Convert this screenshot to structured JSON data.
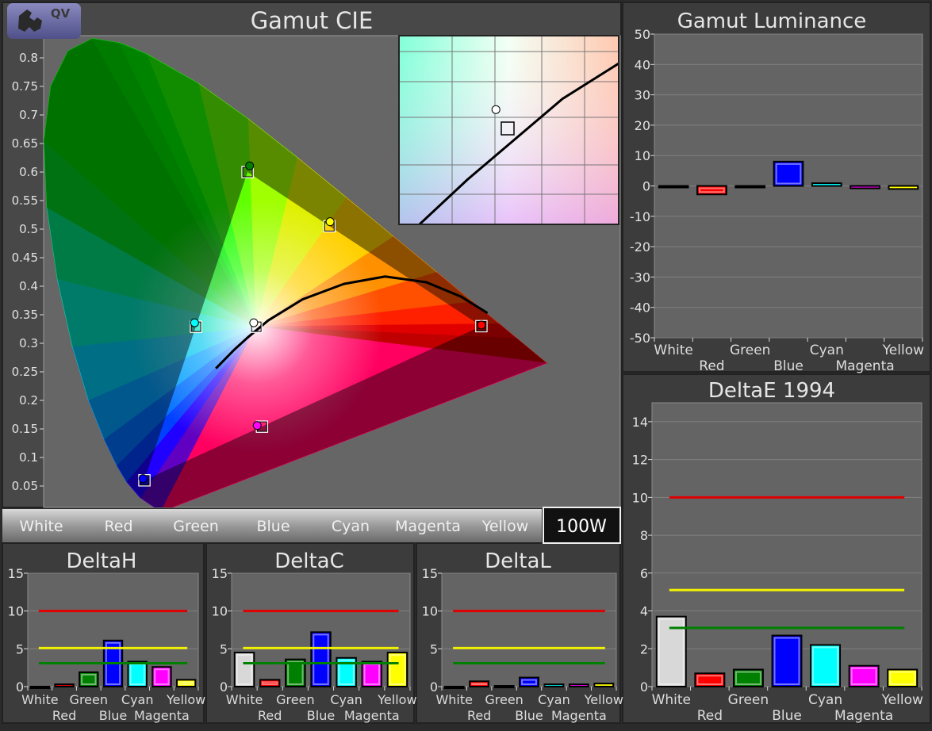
{
  "logo": {
    "text": "QV",
    "icon": "binoculars-icon"
  },
  "patch_bar": {
    "patches": [
      "White",
      "Red",
      "Green",
      "Blue",
      "Cyan",
      "Magenta",
      "Yellow"
    ],
    "selected_button": "100W"
  },
  "colors": {
    "White": "#d8d8d8",
    "Red": "#ff0000",
    "Green": "#008000",
    "Blue": "#0000ff",
    "Cyan": "#00ffff",
    "Magenta": "#ff00ff",
    "Yellow": "#ffff00",
    "threshold_high": "#e00000",
    "threshold_mid": "#f0f000",
    "threshold_low": "#008000"
  },
  "chart_data": [
    {
      "id": "cie",
      "type": "scatter",
      "title": "Gamut CIE",
      "y_ticks": [
        "0.8",
        "0.75",
        "0.7",
        "0.65",
        "0.6",
        "0.55",
        "0.5",
        "0.45",
        "0.4",
        "0.35",
        "0.3",
        "0.25",
        "0.2",
        "0.15",
        "0.1",
        "0.05"
      ],
      "categories": [
        "White",
        "Red",
        "Green",
        "Blue",
        "Cyan",
        "Magenta",
        "Yellow"
      ],
      "targets": [
        [
          0.3127,
          0.329
        ],
        [
          0.64,
          0.33
        ],
        [
          0.3,
          0.6
        ],
        [
          0.15,
          0.06
        ],
        [
          0.225,
          0.329
        ],
        [
          0.321,
          0.154
        ],
        [
          0.419,
          0.505
        ]
      ],
      "measured": [
        [
          0.309,
          0.336
        ],
        [
          0.64,
          0.332
        ],
        [
          0.303,
          0.611
        ],
        [
          0.148,
          0.063
        ],
        [
          0.223,
          0.336
        ],
        [
          0.314,
          0.156
        ],
        [
          0.42,
          0.513
        ]
      ],
      "blackbody_curve": [
        [
          0.254,
          0.256
        ],
        [
          0.28,
          0.288
        ],
        [
          0.3,
          0.31
        ],
        [
          0.33,
          0.34
        ],
        [
          0.38,
          0.377
        ],
        [
          0.44,
          0.404
        ],
        [
          0.5,
          0.417
        ],
        [
          0.56,
          0.407
        ],
        [
          0.61,
          0.382
        ],
        [
          0.649,
          0.353
        ]
      ],
      "inset": "zoom around white point"
    },
    {
      "id": "luminance",
      "type": "bar",
      "title": "Gamut Luminance",
      "categories": [
        "White",
        "Red",
        "Green",
        "Blue",
        "Cyan",
        "Magenta",
        "Yellow"
      ],
      "values": [
        0,
        -2.8,
        -0.3,
        8,
        0.9,
        -0.8,
        -1
      ],
      "ylim": [
        -50,
        50
      ],
      "y_ticks": [
        50,
        40,
        30,
        20,
        10,
        0,
        -10,
        -20,
        -30,
        -40,
        -50
      ],
      "thresholds": []
    },
    {
      "id": "deltae",
      "type": "bar",
      "title": "DeltaE 1994",
      "categories": [
        "White",
        "Red",
        "Green",
        "Blue",
        "Cyan",
        "Magenta",
        "Yellow"
      ],
      "values": [
        3.7,
        0.7,
        0.9,
        2.7,
        2.2,
        1.1,
        0.9
      ],
      "ylim": [
        0,
        15
      ],
      "y_ticks": [
        14,
        12,
        10,
        8,
        6,
        4,
        2,
        0
      ],
      "thresholds": [
        10,
        5.1,
        3.1
      ]
    },
    {
      "id": "deltah",
      "type": "bar",
      "title": "DeltaH",
      "categories": [
        "White",
        "Red",
        "Green",
        "Blue",
        "Cyan",
        "Magenta",
        "Yellow"
      ],
      "values": [
        0,
        0.3,
        1.9,
        6.1,
        3.3,
        2.6,
        0.9
      ],
      "ylim": [
        0,
        15
      ],
      "y_ticks": [
        15,
        10,
        5,
        0
      ],
      "thresholds": [
        10,
        5.1,
        3.1
      ]
    },
    {
      "id": "deltac",
      "type": "bar",
      "title": "DeltaC",
      "categories": [
        "White",
        "Red",
        "Green",
        "Blue",
        "Cyan",
        "Magenta",
        "Yellow"
      ],
      "values": [
        4.5,
        0.9,
        3.6,
        7.2,
        3.8,
        3.3,
        4.5
      ],
      "ylim": [
        0,
        15
      ],
      "y_ticks": [
        15,
        10,
        5,
        0
      ],
      "thresholds": [
        10,
        5.1,
        3.1
      ]
    },
    {
      "id": "deltal",
      "type": "bar",
      "title": "DeltaL",
      "categories": [
        "White",
        "Red",
        "Green",
        "Blue",
        "Cyan",
        "Magenta",
        "Yellow"
      ],
      "values": [
        0,
        0.7,
        0.1,
        1.2,
        0.3,
        0.3,
        0.4
      ],
      "ylim": [
        0,
        15
      ],
      "y_ticks": [
        15,
        10,
        5,
        0
      ],
      "thresholds": [
        10,
        5.1,
        3.1
      ]
    }
  ]
}
